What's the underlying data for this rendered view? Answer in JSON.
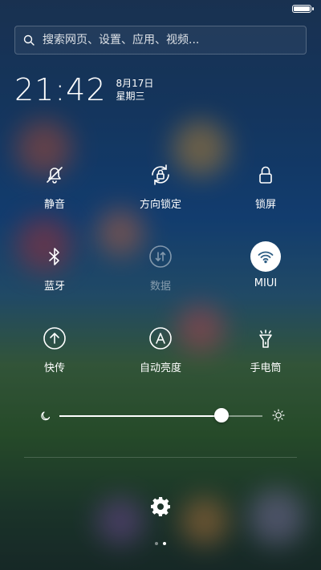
{
  "status_bar": {
    "battery_level": 1.0
  },
  "search": {
    "placeholder": "搜索网页、设置、应用、视频..."
  },
  "clock": {
    "time": "21:42",
    "date": "8月17日",
    "weekday": "星期三"
  },
  "toggles": [
    {
      "label": "静音",
      "icon": "bell-off-icon",
      "active": false
    },
    {
      "label": "方向锁定",
      "icon": "rotation-lock-icon",
      "active": false
    },
    {
      "label": "锁屏",
      "icon": "lock-icon",
      "active": false
    },
    {
      "label": "蓝牙",
      "icon": "bluetooth-icon",
      "active": false
    },
    {
      "label": "数据",
      "icon": "mobile-data-icon",
      "active": false,
      "disabled": true
    },
    {
      "label": "MIUI",
      "icon": "wifi-icon",
      "active": true
    },
    {
      "label": "快传",
      "icon": "upload-arrow-icon",
      "active": false
    },
    {
      "label": "自动亮度",
      "icon": "auto-brightness-icon",
      "active": false
    },
    {
      "label": "手电筒",
      "icon": "flashlight-icon",
      "active": false
    }
  ],
  "brightness": {
    "value": 0.8,
    "min_icon": "moon-icon",
    "max_icon": "sun-icon"
  },
  "pager": {
    "pages": 2,
    "current": 2
  }
}
